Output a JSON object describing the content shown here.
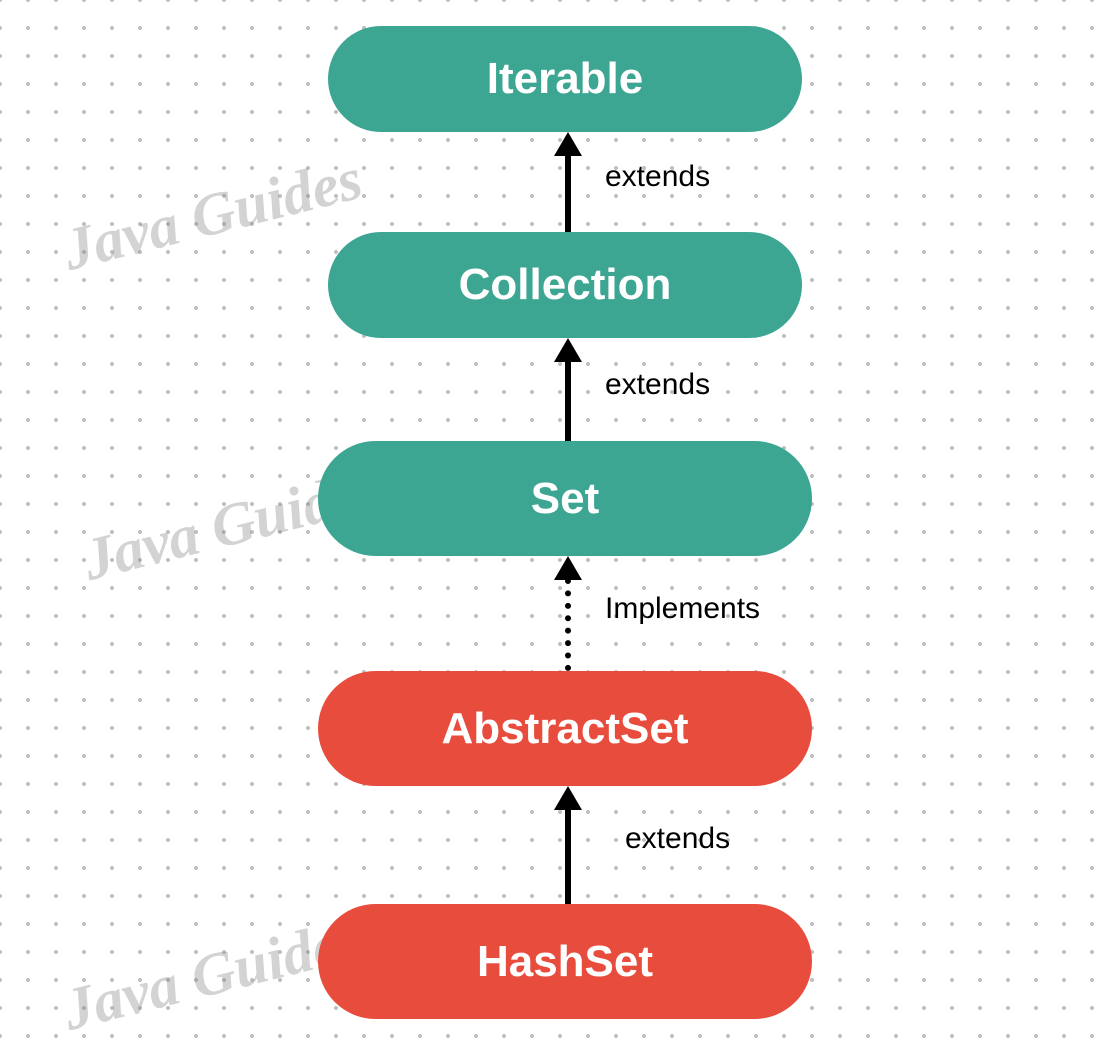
{
  "nodes": {
    "iterable": {
      "label": "Iterable",
      "color": "teal"
    },
    "collection": {
      "label": "Collection",
      "color": "teal"
    },
    "set": {
      "label": "Set",
      "color": "teal"
    },
    "abstractset": {
      "label": "AbstractSet",
      "color": "red"
    },
    "hashset": {
      "label": "HashSet",
      "color": "red"
    }
  },
  "arrows": {
    "collection_to_iterable": {
      "label": "extends",
      "style": "solid"
    },
    "set_to_collection": {
      "label": "extends",
      "style": "solid"
    },
    "abstractset_to_set": {
      "label": "Implements",
      "style": "dashed"
    },
    "hashset_to_abstractset": {
      "label": "extends",
      "style": "solid"
    }
  },
  "watermark": {
    "text": "Java Guides"
  }
}
